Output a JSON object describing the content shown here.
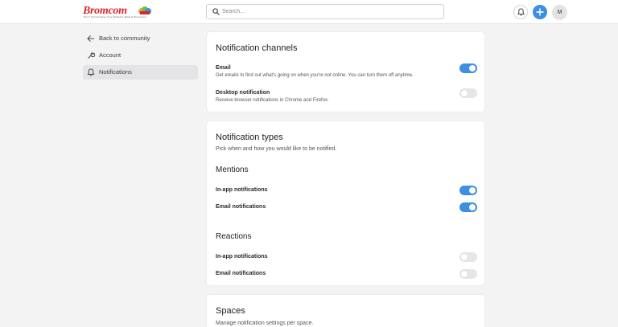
{
  "brand": {
    "name": "Bromcom",
    "tagline": "Don't Compromise Your School's Data & Processes"
  },
  "search": {
    "placeholder": "Search..."
  },
  "header": {
    "avatar_initial": "M"
  },
  "colors": {
    "accent": "#3d8fe0",
    "brand": "#d9262b"
  },
  "sidebar": {
    "items": [
      {
        "label": "Back to community",
        "icon": "arrow-left-icon"
      },
      {
        "label": "Account",
        "icon": "wrench-icon"
      },
      {
        "label": "Notifications",
        "icon": "bell-icon",
        "active": true
      }
    ]
  },
  "channels": {
    "title": "Notification channels",
    "email": {
      "title": "Email",
      "desc": "Get emails to find out what's going on when you're not online. You can turn them off anytime.",
      "enabled": true
    },
    "desktop": {
      "title": "Desktop notification",
      "desc": "Receive browser notifications in Chrome and Firefox.",
      "enabled": false
    }
  },
  "types": {
    "title": "Notification types",
    "subtitle": "Pick when and how you would like to be notified.",
    "mentions": {
      "title": "Mentions",
      "in_app": {
        "label": "In-app notifications",
        "enabled": true
      },
      "email": {
        "label": "Email notifications",
        "enabled": true
      }
    },
    "reactions": {
      "title": "Reactions",
      "in_app": {
        "label": "In-app notifications",
        "enabled": false
      },
      "email": {
        "label": "Email notifications",
        "enabled": false
      }
    }
  },
  "spaces": {
    "title": "Spaces",
    "subtitle": "Manage notification settings per space."
  }
}
